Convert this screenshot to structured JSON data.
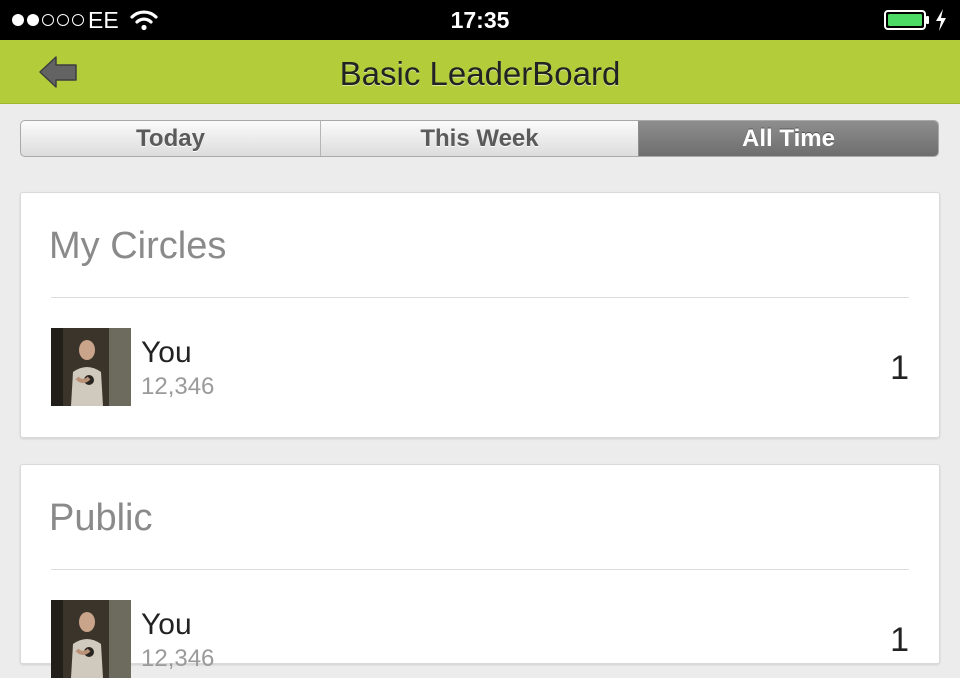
{
  "status_bar": {
    "carrier": "EE",
    "time": "17:35",
    "signal_bars_filled": 2,
    "signal_bars_total": 5,
    "battery_level": 1.0,
    "charging": true,
    "battery_color": "#4cd964"
  },
  "nav": {
    "title": "Basic LeaderBoard",
    "back_icon": "back-arrow-icon",
    "bar_color": "#b2cc3a"
  },
  "tabs": [
    {
      "label": "Today",
      "selected": false
    },
    {
      "label": "This Week",
      "selected": false
    },
    {
      "label": "All Time",
      "selected": true
    }
  ],
  "sections": [
    {
      "title": "My Circles",
      "entries": [
        {
          "name": "You",
          "score": "12,346",
          "rank": "1"
        }
      ]
    },
    {
      "title": "Public",
      "entries": [
        {
          "name": "You",
          "score": "12,346",
          "rank": "1"
        }
      ]
    }
  ]
}
